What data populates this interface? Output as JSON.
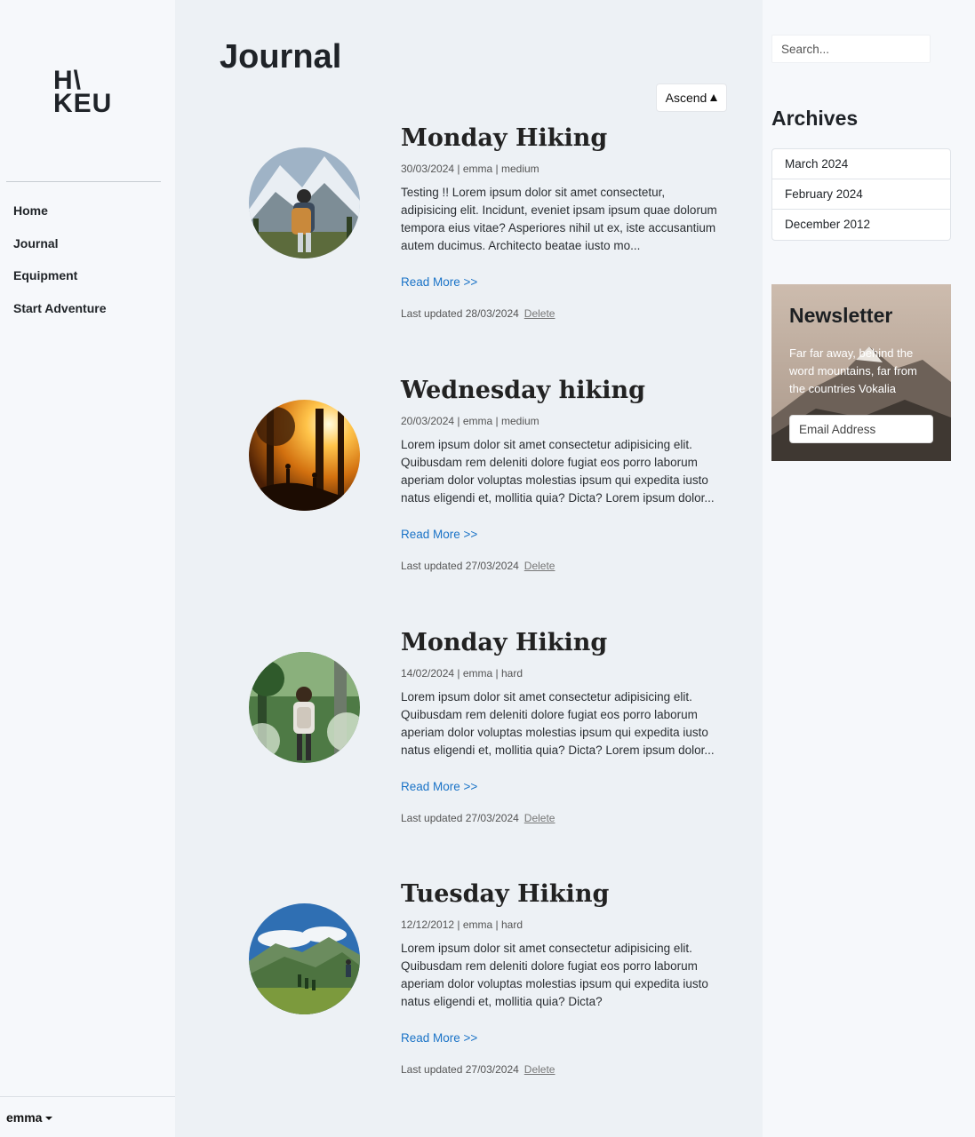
{
  "brand": {
    "line1": "H\\",
    "line2": "KEU"
  },
  "nav": {
    "items": [
      "Home",
      "Journal",
      "Equipment",
      "Start Adventure"
    ]
  },
  "user": {
    "name": "emma"
  },
  "main": {
    "title": "Journal",
    "sort_label": "Ascend",
    "read_more_label": "Read More >>",
    "delete_label": "Delete",
    "posts": [
      {
        "title": "Monday Hiking",
        "meta": "30/03/2024 | emma | medium",
        "excerpt": "Testing !! Lorem ipsum dolor sit amet consectetur, adipisicing elit. Incidunt, eveniet ipsam ipsum quae dolorum tempora eius vitae? Asperiores nihil ut ex, iste accusantium autem ducimus. Architecto beatae iusto mo...",
        "updated": "Last updated 28/03/2024",
        "image": "hiker-snowy-mountains"
      },
      {
        "title": "Wednesday hiking",
        "meta": "20/03/2024 | emma | medium",
        "excerpt": "Lorem ipsum dolor sit amet consectetur adipisicing elit. Quibusdam rem deleniti dolore fugiat eos porro laborum aperiam dolor voluptas molestias ipsum qui expedita iusto natus eligendi et, mollitia quia? Dicta? Lorem ipsum dolor...",
        "updated": "Last updated 27/03/2024",
        "image": "sunset-forest-silhouettes"
      },
      {
        "title": "Monday Hiking",
        "meta": "14/02/2024 | emma | hard",
        "excerpt": "Lorem ipsum dolor sit amet consectetur adipisicing elit. Quibusdam rem deleniti dolore fugiat eos porro laborum aperiam dolor voluptas molestias ipsum qui expedita iusto natus eligendi et, mollitia quia? Dicta? Lorem ipsum dolor...",
        "updated": "Last updated 27/03/2024",
        "image": "hiker-green-forest"
      },
      {
        "title": "Tuesday Hiking",
        "meta": "12/12/2012 | emma | hard",
        "excerpt": "Lorem ipsum dolor sit amet consectetur adipisicing elit. Quibusdam rem deleniti dolore fugiat eos porro laborum aperiam dolor voluptas molestias ipsum qui expedita iusto natus eligendi et, mollitia quia? Dicta?",
        "updated": "Last updated 27/03/2024",
        "image": "green-mountain-valley"
      }
    ]
  },
  "sidebar_right": {
    "search_placeholder": "Search...",
    "archives_title": "Archives",
    "archives": [
      "March 2024",
      "February 2024",
      "December 2012"
    ],
    "newsletter": {
      "title": "Newsletter",
      "text": "Far far away, behind the word mountains, far from the countries Vokalia",
      "email_placeholder": "Email Address"
    }
  },
  "colors": {
    "link": "#1a73c7",
    "main_bg": "#edf1f5",
    "sidebar_bg": "#f6f8fb"
  }
}
